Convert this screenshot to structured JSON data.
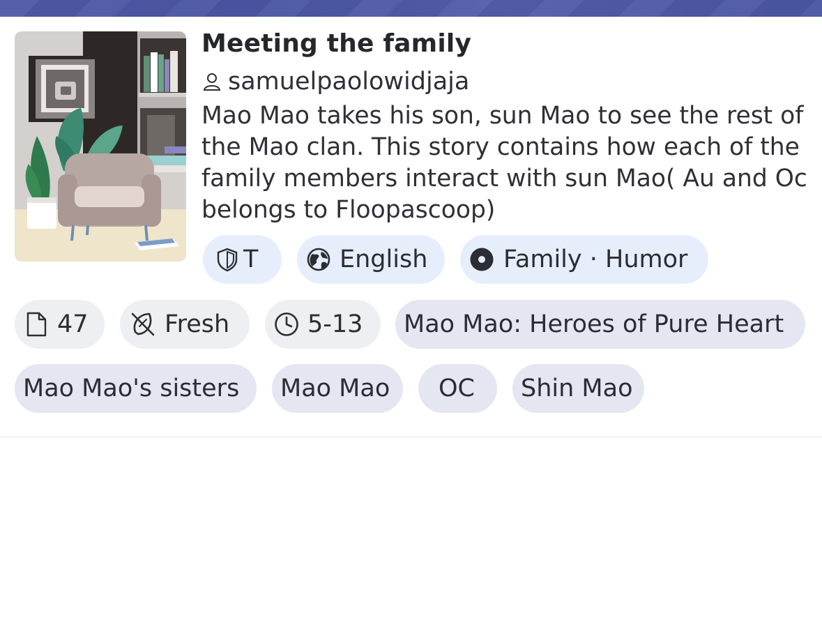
{
  "story": {
    "title": "Meeting the family",
    "author": "samuelpaolowidjaja",
    "description": "Mao Mao takes his son, sun Mao to see the rest of the Mao clan. This story contains how each of the family members interact with sun Mao( Au and Oc belongs to Floopascoop)"
  },
  "meta": {
    "rating": "T",
    "language": "English",
    "genres": "Family · Humor",
    "chapters": "47",
    "status": "Fresh",
    "age_range": "5-13"
  },
  "tags": [
    "Mao Mao: Heroes of Pure Heart",
    "Mao Mao's sisters",
    "Mao Mao",
    "OC",
    "Shin Mao"
  ],
  "icons": {
    "rating": "shield-icon",
    "language": "globe-icon",
    "genres": "lifebuoy-icon",
    "chapters": "document-icon",
    "status": "leaf-icon",
    "age_range": "clock-icon",
    "author": "user-icon"
  },
  "colors": {
    "header": "#4f5aa6",
    "chip_blue": "#e6eefb",
    "chip_grey": "#eeeff2",
    "chip_tag": "#e4e6f2",
    "text": "#26272b"
  }
}
